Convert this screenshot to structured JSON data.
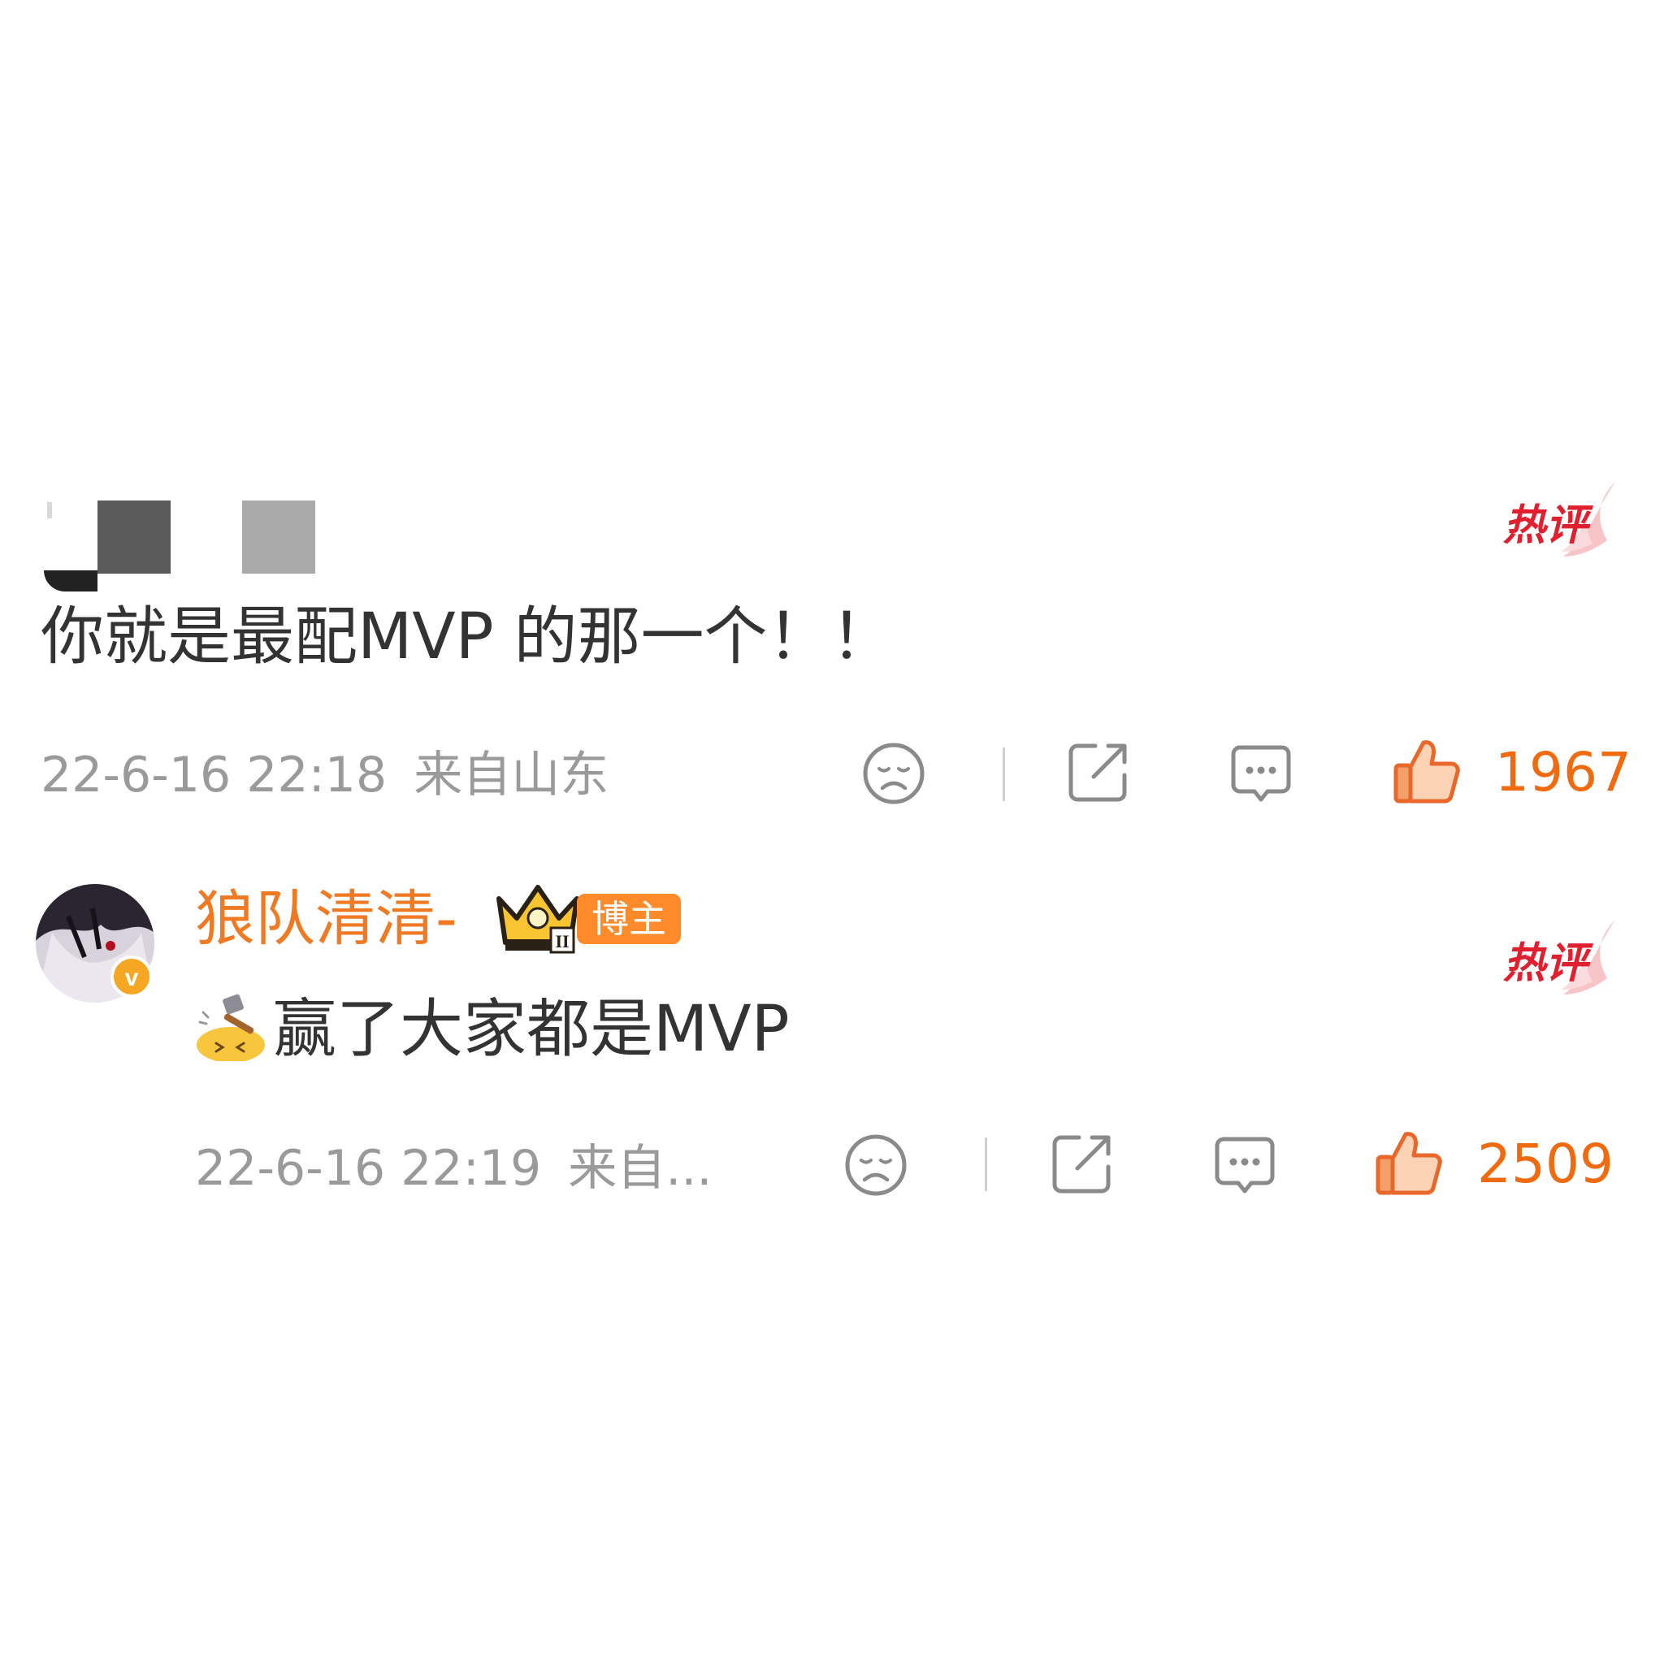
{
  "comments": [
    {
      "username": "",
      "text": "你就是最配MVP 的那一个！！",
      "timestamp": "22-6-16 22:18",
      "location": "来自山东",
      "likes": "1967",
      "hot_label": "热评"
    },
    {
      "username": "狼队清清-",
      "role_badge": "博主",
      "text": "赢了大家都是MVP",
      "timestamp": "22-6-16 22:19",
      "location": "来自...",
      "likes": "2509",
      "hot_label": "热评"
    }
  ],
  "icons": {
    "dislike": "sad-face-icon",
    "share": "share-icon",
    "reply": "comment-bubble-icon",
    "like": "thumbs-up-icon",
    "crown": "crown-badge-icon",
    "emoji": "hammer-emoji-icon",
    "verified": "verified-v-icon"
  },
  "colors": {
    "accent": "#f07a23",
    "hot": "#e0202f",
    "meta": "#9a9a9a",
    "text": "#333333"
  }
}
